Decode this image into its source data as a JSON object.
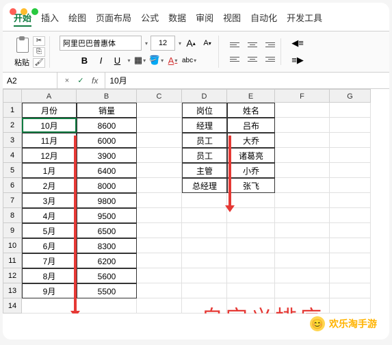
{
  "window": {
    "close": "",
    "min": "",
    "max": ""
  },
  "tabs": [
    "开始",
    "插入",
    "绘图",
    "页面布局",
    "公式",
    "数据",
    "审阅",
    "视图",
    "自动化",
    "开发工具"
  ],
  "activeTab": 0,
  "ribbon": {
    "paste_label": "粘贴",
    "font_name": "阿里巴巴普惠体",
    "font_size": "12",
    "bold": "B",
    "italic": "I",
    "underline": "U",
    "increase_font": "A",
    "decrease_font": "A",
    "abc": "abc"
  },
  "namebox": {
    "cell_ref": "A2",
    "fx": "fx",
    "formula": "10月",
    "cancel": "×",
    "confirm": "✓"
  },
  "columns": [
    "A",
    "B",
    "C",
    "D",
    "E",
    "F",
    "G"
  ],
  "table1": {
    "headers": [
      "月份",
      "销量"
    ],
    "rows": [
      [
        "10月",
        "8600"
      ],
      [
        "11月",
        "6000"
      ],
      [
        "12月",
        "3900"
      ],
      [
        "1月",
        "6400"
      ],
      [
        "2月",
        "8000"
      ],
      [
        "3月",
        "9800"
      ],
      [
        "4月",
        "9500"
      ],
      [
        "5月",
        "6500"
      ],
      [
        "6月",
        "8300"
      ],
      [
        "7月",
        "6200"
      ],
      [
        "8月",
        "5600"
      ],
      [
        "9月",
        "5500"
      ]
    ]
  },
  "table2": {
    "headers": [
      "岗位",
      "姓名"
    ],
    "rows": [
      [
        "经理",
        "吕布"
      ],
      [
        "员工",
        "大乔"
      ],
      [
        "员工",
        "诸葛亮"
      ],
      [
        "主管",
        "小乔"
      ],
      [
        "总经理",
        "张飞"
      ]
    ]
  },
  "annotation": "自定义排序",
  "watermark": {
    "emoji": "😊",
    "text": "欢乐淘手游"
  },
  "chart_data": [
    {
      "type": "table",
      "title": "月份 / 销量",
      "categories": [
        "10月",
        "11月",
        "12月",
        "1月",
        "2月",
        "3月",
        "4月",
        "5月",
        "6月",
        "7月",
        "8月",
        "9月"
      ],
      "values": [
        8600,
        6000,
        3900,
        6400,
        8000,
        9800,
        9500,
        6500,
        8300,
        6200,
        5600,
        5500
      ],
      "xlabel": "月份",
      "ylabel": "销量"
    },
    {
      "type": "table",
      "title": "岗位 / 姓名",
      "series": [
        {
          "name": "岗位",
          "values": [
            "经理",
            "员工",
            "员工",
            "主管",
            "总经理"
          ]
        },
        {
          "name": "姓名",
          "values": [
            "吕布",
            "大乔",
            "诸葛亮",
            "小乔",
            "张飞"
          ]
        }
      ]
    }
  ]
}
